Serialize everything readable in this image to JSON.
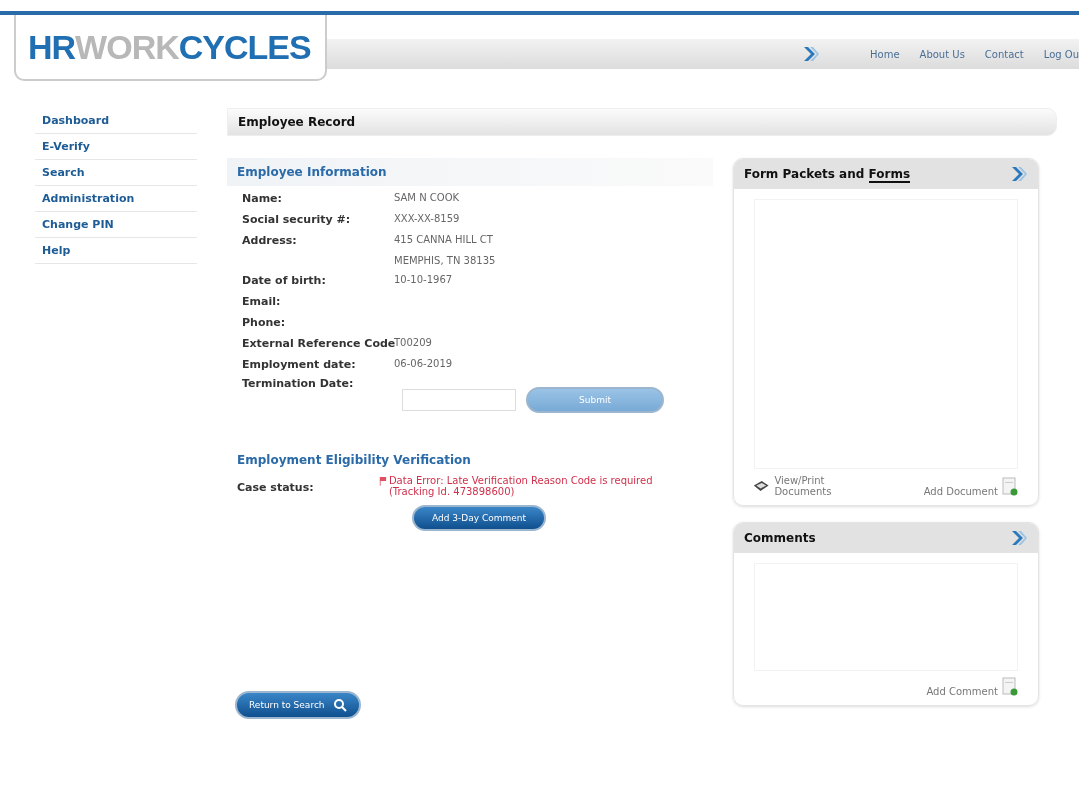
{
  "logo": {
    "parts": [
      {
        "text": "HR",
        "color": "#1f6fb2"
      },
      {
        "text": "WORK",
        "color": "#b8b8b8"
      },
      {
        "text": "CYCLES",
        "color": "#1f6fb2"
      }
    ]
  },
  "nav": [
    "Home",
    "About Us",
    "Contact",
    "Log Ou"
  ],
  "sidebar": {
    "items": [
      {
        "label": "Dashboard"
      },
      {
        "label": "E-Verify"
      },
      {
        "label": "Search"
      },
      {
        "label": "Administration"
      },
      {
        "label": "Change PIN"
      },
      {
        "label": "Help"
      }
    ]
  },
  "page_title": "Employee Record",
  "employee_information": {
    "title": "Employee Information",
    "fields": [
      {
        "label": "Name:",
        "value": [
          "SAM N COOK"
        ]
      },
      {
        "label": "Social security #:",
        "value": [
          "XXX-XX-8159"
        ]
      },
      {
        "label": "Address:",
        "value": [
          "415 CANNA HILL CT",
          "MEMPHIS, TN 38135"
        ]
      },
      {
        "label": "Date of birth:",
        "value": [
          "10-10-1967"
        ]
      },
      {
        "label": "Email:"
      },
      {
        "label": "Phone:"
      },
      {
        "label": "External Reference Code",
        "value": [
          "T00209"
        ]
      },
      {
        "label": "Employment date:",
        "value": [
          "06-06-2019"
        ]
      }
    ],
    "termination": {
      "label": "Termination Date:",
      "button": "Submit",
      "button_disabled": true
    }
  },
  "verification": {
    "title": "Employment Eligibility Verification",
    "label": "Case status:",
    "status": "Data Error: Late Verification Reason Code is required (Tracking Id. 473898600)",
    "button": "Add 3-Day Comment"
  },
  "forms_panel": {
    "title": "Form Packets and",
    "title_link": "Forms",
    "view_print": "View/Print Documents",
    "add": "Add Document"
  },
  "comments_panel": {
    "title": "Comments",
    "add": "Add Comment"
  },
  "return_button": "Return to Search"
}
